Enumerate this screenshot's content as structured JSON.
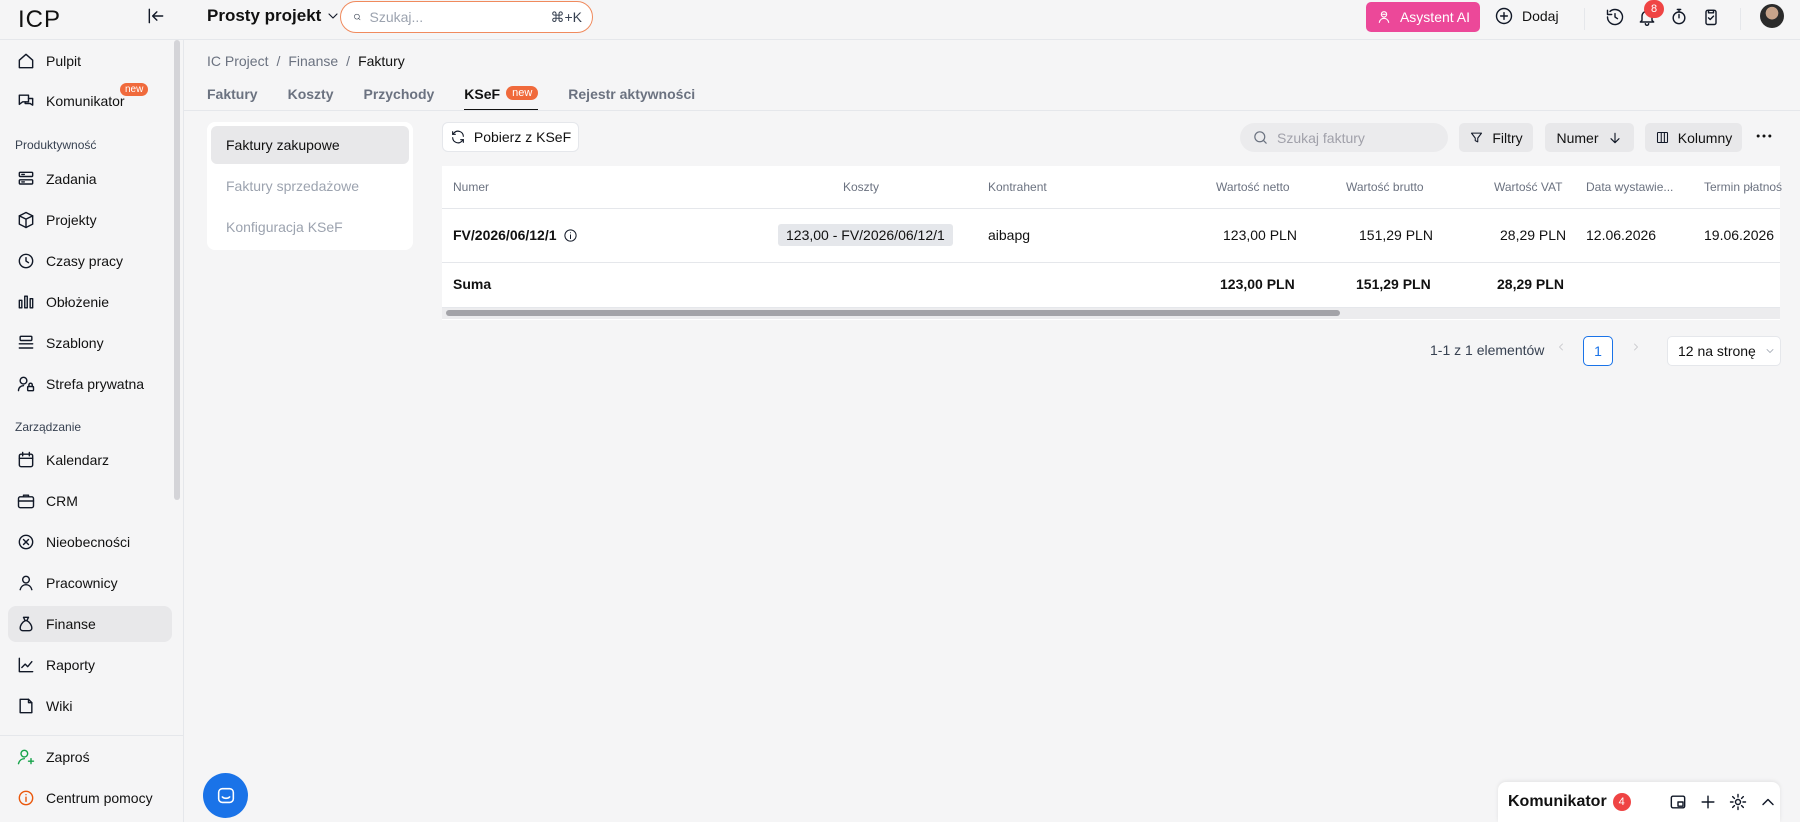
{
  "app": {
    "logo": "ICP",
    "project": "Prosty projekt"
  },
  "search": {
    "placeholder": "Szukaj...",
    "shortcut": "⌘+K"
  },
  "topbar": {
    "ai_label": "Asystent AI",
    "add_label": "Dodaj",
    "notifications_count": "8"
  },
  "sidebar": {
    "items_top": [
      {
        "label": "Pulpit",
        "icon": "home-icon"
      },
      {
        "label": "Komunikator",
        "icon": "chat-icon",
        "tag": "new"
      }
    ],
    "section_productivity": "Produktywność",
    "items_productivity": [
      {
        "label": "Zadania",
        "icon": "tasks-icon"
      },
      {
        "label": "Projekty",
        "icon": "box-icon"
      },
      {
        "label": "Czasy pracy",
        "icon": "clock-icon"
      },
      {
        "label": "Obłożenie",
        "icon": "bar-chart-icon"
      },
      {
        "label": "Szablony",
        "icon": "layers-icon"
      },
      {
        "label": "Strefa prywatna",
        "icon": "user-lock-icon"
      }
    ],
    "section_management": "Zarządzanie",
    "items_management": [
      {
        "label": "Kalendarz",
        "icon": "calendar-icon"
      },
      {
        "label": "CRM",
        "icon": "briefcase-icon"
      },
      {
        "label": "Nieobecności",
        "icon": "x-circle-icon"
      },
      {
        "label": "Pracownicy",
        "icon": "users-icon"
      },
      {
        "label": "Finanse",
        "icon": "money-bag-icon",
        "active": true
      },
      {
        "label": "Raporty",
        "icon": "line-chart-icon"
      },
      {
        "label": "Wiki",
        "icon": "book-icon"
      }
    ],
    "bottom": [
      {
        "label": "Zaproś",
        "icon": "user-plus-icon"
      },
      {
        "label": "Centrum pomocy",
        "icon": "info-icon"
      }
    ]
  },
  "breadcrumb": [
    "IC Project",
    "Finanse",
    "Faktury"
  ],
  "tabs": [
    {
      "label": "Faktury"
    },
    {
      "label": "Koszty"
    },
    {
      "label": "Przychody"
    },
    {
      "label": "KSeF",
      "tag": "new",
      "active": true
    },
    {
      "label": "Rejestr aktywności"
    }
  ],
  "subnav": [
    "Faktury zakupowe",
    "Faktury sprzedażowe",
    "Konfiguracja KSeF"
  ],
  "toolbar": {
    "fetch_label": "Pobierz z KSeF",
    "search_placeholder": "Szukaj faktury",
    "filters_label": "Filtry",
    "sort_label": "Numer",
    "columns_label": "Kolumny"
  },
  "table": {
    "headers": [
      "Numer",
      "Koszty",
      "Kontrahent",
      "Wartość netto",
      "Wartość brutto",
      "Wartość VAT",
      "Data wystawie...",
      "Termin płatnoś"
    ],
    "rows": [
      {
        "numer": "FV/2026/06/12/1",
        "koszty": "123,00 - FV/2026/06/12/1",
        "kontrahent": "aibapg",
        "netto": "123,00 PLN",
        "brutto": "151,29 PLN",
        "vat": "28,29 PLN",
        "data": "12.06.2026",
        "termin": "19.06.2026"
      }
    ],
    "sum": {
      "label": "Suma",
      "netto": "123,00 PLN",
      "brutto": "151,29 PLN",
      "vat": "28,29 PLN"
    }
  },
  "pagination": {
    "range_text": "1-1 z 1 elementów",
    "current_page": "1",
    "page_size": "12 na stronę"
  },
  "komunikator": {
    "title": "Komunikator",
    "count": "4"
  },
  "colors": {
    "accent": "#1a73e8",
    "ai": "#ec4899",
    "new_tag": "#f06a3c",
    "badge": "#ef4444",
    "search_border": "#f08a5d"
  }
}
